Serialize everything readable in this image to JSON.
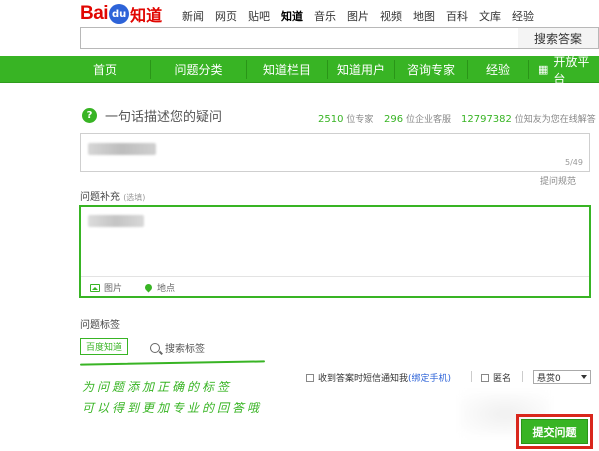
{
  "header": {
    "logo_bai": "Bai",
    "logo_du": "du",
    "logo_zhidao": "知道",
    "nav_links": [
      "新闻",
      "网页",
      "贴吧",
      "知道",
      "音乐",
      "图片",
      "视频",
      "地图",
      "百科",
      "文库",
      "经验"
    ],
    "active_link": "知道",
    "search_value": "",
    "search_button": "搜索答案"
  },
  "green_nav": {
    "items": [
      "首页",
      "问题分类",
      "知道栏目",
      "知道用户",
      "咨询专家",
      "经验",
      "开放平台"
    ]
  },
  "ask": {
    "title": "一句话描述您的疑问",
    "stat_experts_num": "2510",
    "stat_experts_label": "位专家",
    "stat_service_num": "296",
    "stat_service_label": "位企业客服",
    "stat_friends_num": "12797382",
    "stat_friends_label": "位知友为您在线解答",
    "counter": "5/49",
    "standard_link": "提问规范"
  },
  "supplement": {
    "label": "问题补充",
    "optional": "(选填)",
    "image_tool": "图片",
    "location_tool": "地点"
  },
  "tags": {
    "label": "问题标签",
    "chip": "百度知道",
    "search": "搜索标签"
  },
  "annotation": {
    "line1": "为问题添加正确的标签",
    "line2": "可以得到更加专业的回答哦"
  },
  "options": {
    "sms_notify": "收到答案时短信通知我",
    "bind_phone": "(绑定手机)",
    "anonymous": "匿名",
    "reward_value": "悬赏0"
  },
  "submit": {
    "label": "提交问题",
    "highlight_color": "#d9261c"
  },
  "colors": {
    "brand_green": "#38b424",
    "logo_red": "#e10601"
  }
}
